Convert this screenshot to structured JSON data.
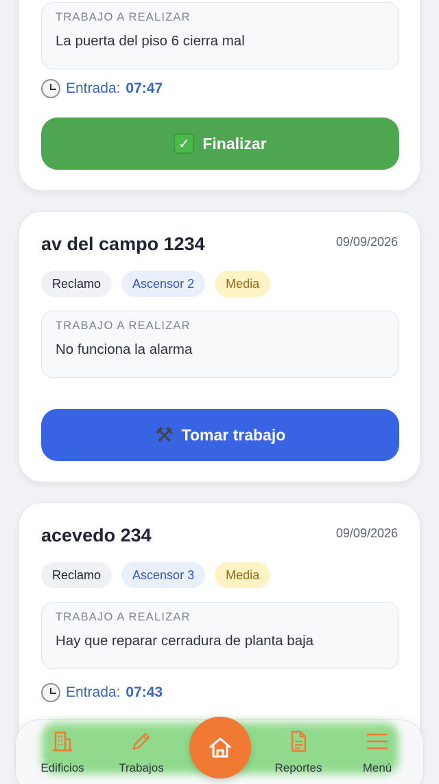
{
  "jobs": [
    {
      "work_label": "TRABAJO A REALIZAR",
      "work_text": "La puerta del piso 6 cierra mal",
      "entry_label": "Entrada:",
      "entry_time": "07:47",
      "action_label": "Finalizar",
      "action_icon": "check-mark-button-icon"
    },
    {
      "title": "av del campo 1234",
      "date": "09/09/2026",
      "tags": [
        "Reclamo",
        "Ascensor 2",
        "Media"
      ],
      "work_label": "TRABAJO A REALIZAR",
      "work_text": "No funciona la alarma",
      "action_label": "Tomar trabajo",
      "action_icon": "hammer-wrench-icon"
    },
    {
      "title": "acevedo 234",
      "date": "09/09/2026",
      "tags": [
        "Reclamo",
        "Ascensor 3",
        "Media"
      ],
      "work_label": "TRABAJO A REALIZAR",
      "work_text": "Hay que reparar cerradura de planta baja",
      "entry_label": "Entrada:",
      "entry_time": "07:43"
    }
  ],
  "nav": {
    "items": [
      {
        "label": "Edificios",
        "icon": "building-icon"
      },
      {
        "label": "Trabajos",
        "icon": "pencil-icon"
      },
      {
        "label": "",
        "icon": "home-icon"
      },
      {
        "label": "Reportes",
        "icon": "document-icon"
      },
      {
        "label": "Menú",
        "icon": "menu-icon"
      }
    ]
  },
  "colors": {
    "accent_orange": "#f07a34",
    "finish_green": "#4ea652",
    "take_blue": "#3863e3",
    "entry_blue": "#3a66c4"
  }
}
